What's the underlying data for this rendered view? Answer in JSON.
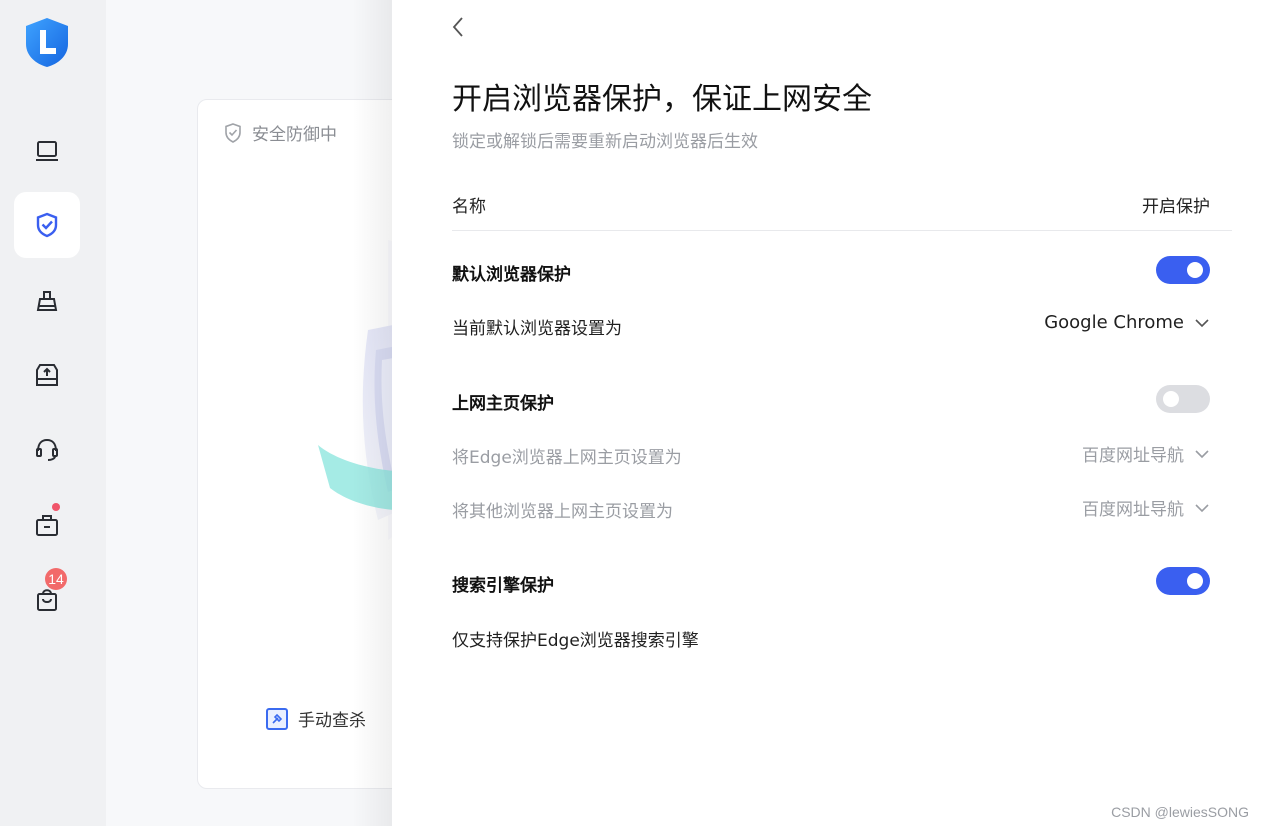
{
  "sidebar": {
    "nav_icons": [
      "monitor-icon",
      "shield-check-icon",
      "broom-icon",
      "disk-upload-icon",
      "headset-icon",
      "toolbox-icon",
      "bag-icon"
    ],
    "active_index": 1,
    "accent_color": "#3a5ff0",
    "bag_badge": "14"
  },
  "background": {
    "card_status": "安全防御中",
    "manual_scan": "手动查杀"
  },
  "panel": {
    "title": "开启浏览器保护，保证上网安全",
    "subtitle": "锁定或解锁后需要重新启动浏览器后生效",
    "header": {
      "name": "名称",
      "protect": "开启保护"
    },
    "default_browser": {
      "label": "默认浏览器保护",
      "enabled": true,
      "setting_label": "当前默认浏览器设置为",
      "setting_value": "Google Chrome"
    },
    "homepage": {
      "label": "上网主页保护",
      "enabled": false,
      "edge_label": "将Edge浏览器上网主页设置为",
      "edge_value": "百度网址导航",
      "other_label": "将其他浏览器上网主页设置为",
      "other_value": "百度网址导航"
    },
    "search_engine": {
      "label": "搜索引擎保护",
      "enabled": true,
      "note": "仅支持保护Edge浏览器搜索引擎"
    }
  },
  "watermark": "CSDN @lewiesSONG"
}
